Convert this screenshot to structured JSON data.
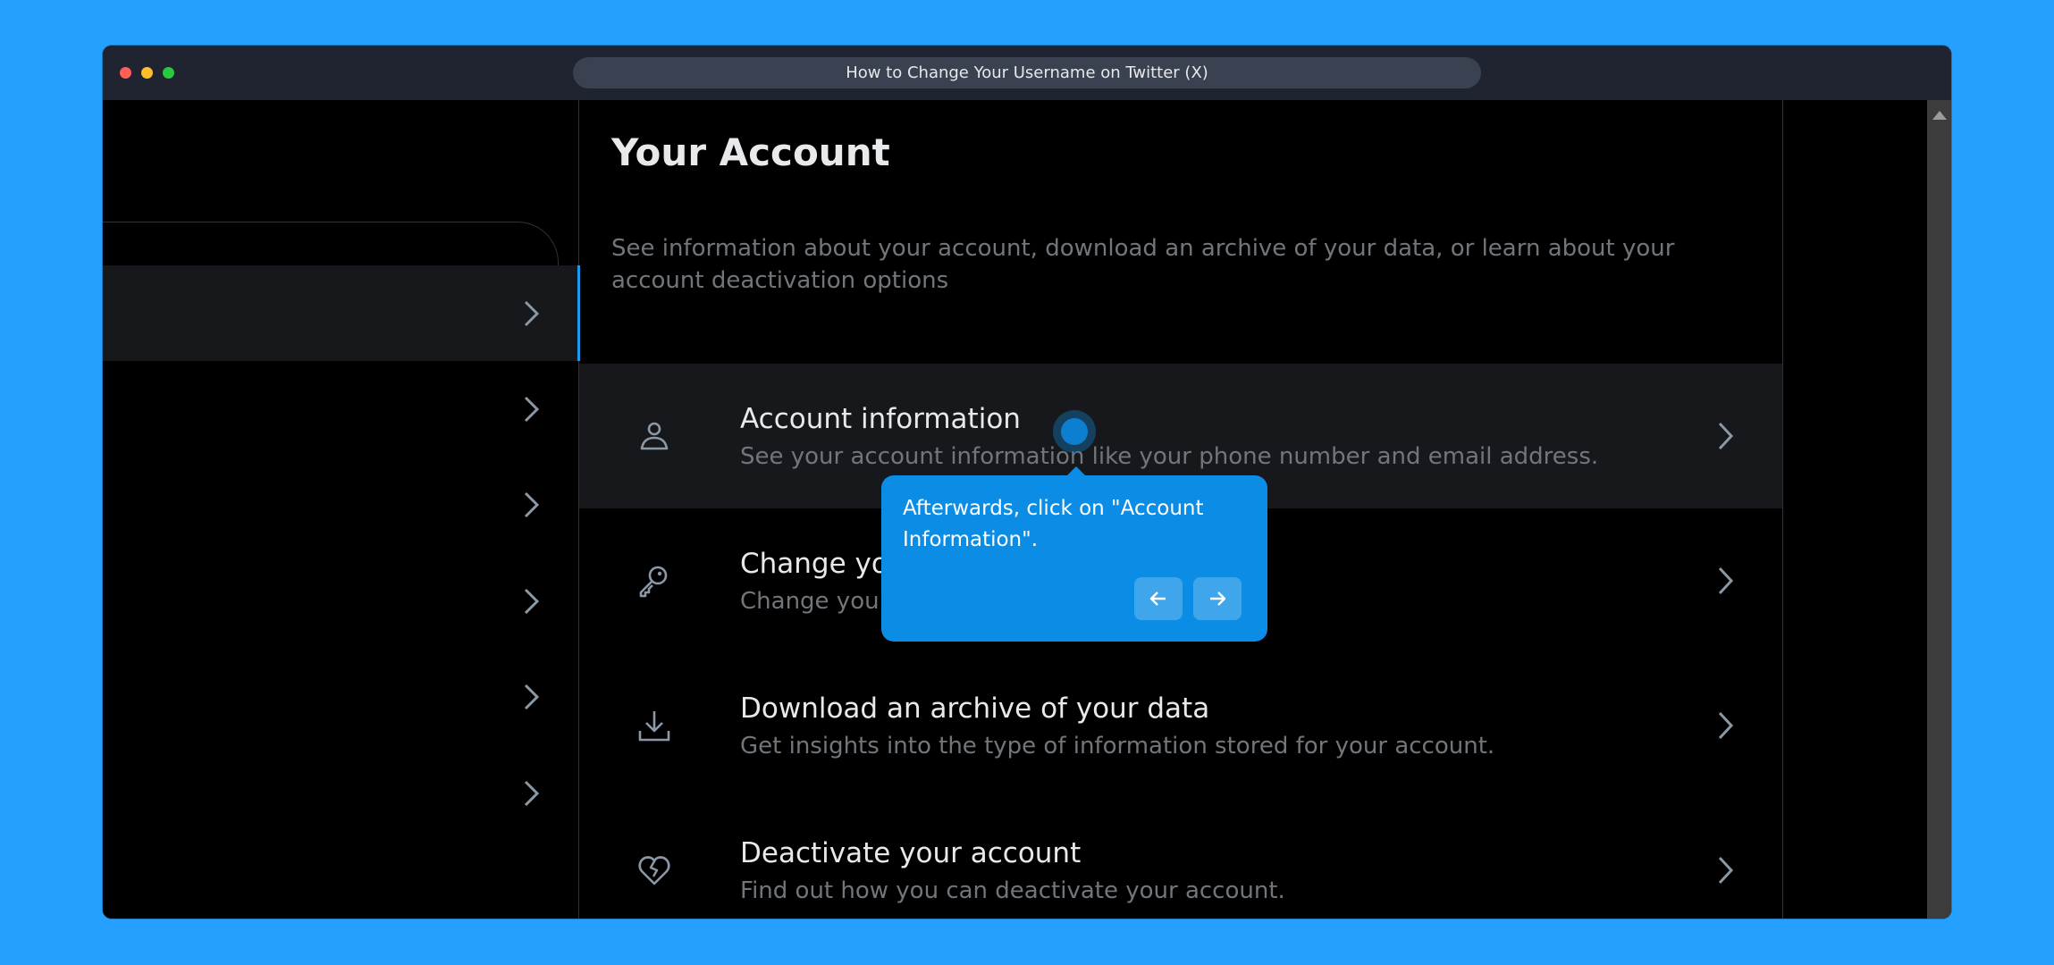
{
  "browser": {
    "title": "How to Change Your Username on Twitter (X)"
  },
  "page": {
    "title": "Your Account",
    "description": "See information about your account, download an archive of your data, or learn about your account deactivation options"
  },
  "sidebar": {
    "items": [
      {
        "state": "active",
        "icon": "chevron-right-icon"
      },
      {
        "state": "normal",
        "icon": "chevron-right-icon"
      },
      {
        "state": "normal",
        "icon": "chevron-right-icon"
      },
      {
        "state": "normal",
        "icon": "chevron-right-icon"
      },
      {
        "state": "normal",
        "icon": "chevron-right-icon"
      },
      {
        "state": "normal",
        "icon": "chevron-right-icon"
      }
    ]
  },
  "settings": {
    "items": [
      {
        "title": "Account information",
        "subtitle": "See your account information like your phone number and email address.",
        "icon": "person-icon"
      },
      {
        "title": "Change your password",
        "subtitle": "Change your password at any time.",
        "icon": "key-icon"
      },
      {
        "title": "Download an archive of your data",
        "subtitle": "Get insights into the type of information stored for your account.",
        "icon": "download-icon"
      },
      {
        "title": "Deactivate your account",
        "subtitle": "Find out how you can deactivate your account.",
        "icon": "broken-heart-icon"
      }
    ]
  },
  "tooltip": {
    "text": "Afterwards, click on \"Account Information\".",
    "prev_icon": "arrow-left-icon",
    "next_icon": "arrow-right-icon"
  },
  "colors": {
    "background": "#26a0fe",
    "accent": "#1d9bf0",
    "tooltip": "#0b8de6"
  }
}
